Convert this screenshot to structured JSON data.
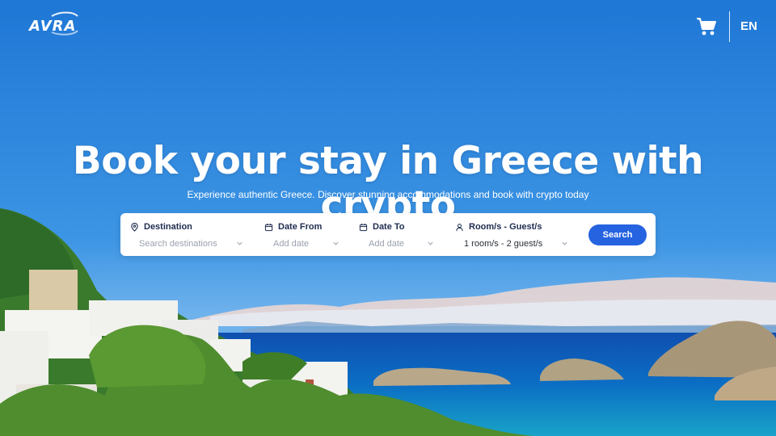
{
  "brand": {
    "logo_text": "AVRA"
  },
  "header": {
    "language": "EN"
  },
  "hero": {
    "title": "Book your stay in Greece with crypto",
    "subtitle": "Experience authentic Greece. Discover stunning accommodations and book with crypto today"
  },
  "search": {
    "destination": {
      "label": "Destination",
      "placeholder": "Search destinations",
      "icon": "location-pin-icon"
    },
    "date_from": {
      "label": "Date From",
      "placeholder": "Add date",
      "icon": "calendar-icon"
    },
    "date_to": {
      "label": "Date To",
      "placeholder": "Add date",
      "icon": "calendar-icon"
    },
    "rooms": {
      "label": "Room/s - Guest/s",
      "value": "1 room/s - 2 guest/s",
      "icon": "user-icon"
    },
    "button_label": "Search"
  },
  "colors": {
    "accent": "#2563e0",
    "label_text": "#1e2c4f",
    "placeholder": "#9aa1ad",
    "sky": "#2f86dc"
  }
}
